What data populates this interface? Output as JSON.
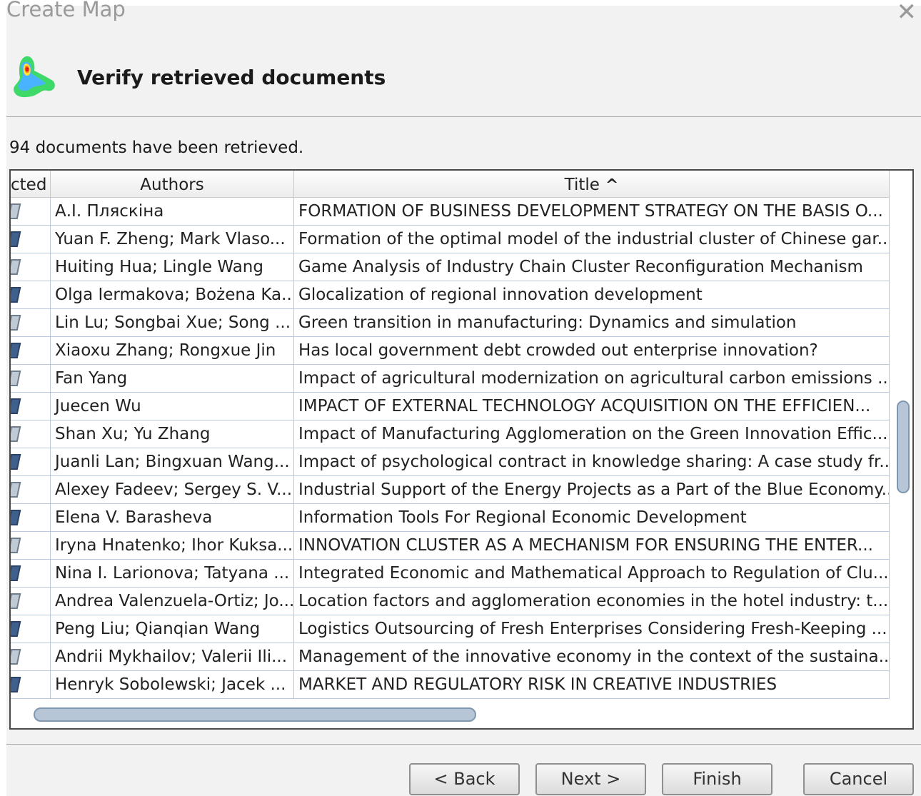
{
  "window": {
    "title": "Create Map",
    "close_glyph": "✕"
  },
  "header": {
    "heading": "Verify retrieved documents",
    "logo_icon": "vosviewer-heatmap-logo"
  },
  "status_text": "94 documents have been retrieved.",
  "table": {
    "columns": {
      "selected": "cted",
      "authors": "Authors",
      "title": "Title"
    },
    "sort_indicator": "^",
    "rows": [
      {
        "authors": "А.І. Пляскіна",
        "title": "FORMATION OF BUSINESS DEVELOPMENT STRATEGY ON THE BASIS O..."
      },
      {
        "authors": "Yuan F. Zheng; Mark Vlaso...",
        "title": "Formation of the optimal model of the industrial cluster of Chinese gar..."
      },
      {
        "authors": "Huiting Hua; Lingle Wang",
        "title": "Game Analysis of Industry Chain Cluster Reconfiguration Mechanism"
      },
      {
        "authors": "Olga Iermakova; Bożena Ka...",
        "title": "Glocalization of regional innovation development"
      },
      {
        "authors": "Lin Lu; Songbai Xue; Song ...",
        "title": "Green transition in manufacturing: Dynamics and simulation"
      },
      {
        "authors": "Xiaoxu Zhang; Rongxue Jin",
        "title": "Has local government debt crowded out enterprise innovation?"
      },
      {
        "authors": "Fan Yang",
        "title": "Impact of agricultural modernization on agricultural carbon emissions ..."
      },
      {
        "authors": "Juecen Wu",
        "title": "IMPACT OF EXTERNAL TECHNOLOGY ACQUISITION ON THE EFFICIEN..."
      },
      {
        "authors": "Shan Xu; Yu Zhang",
        "title": "Impact of Manufacturing Agglomeration on the Green Innovation Effic..."
      },
      {
        "authors": "Juanli Lan; Bingxuan Wang...",
        "title": "Impact of psychological contract in knowledge sharing: A case study fr..."
      },
      {
        "authors": "Alexey Fadeev; Sergey S. V...",
        "title": "Industrial Support of the Energy Projects as a Part of the Blue Economy..."
      },
      {
        "authors": "Elena V. Barasheva",
        "title": "Information Tools For Regional Economic Development"
      },
      {
        "authors": "Iryna Hnatenko; Ihor Kuksa...",
        "title": "INNOVATION CLUSTER AS A MECHANISM FOR ENSURING THE ENTER..."
      },
      {
        "authors": "Nina I. Larionova; Tatyana ...",
        "title": "Integrated Economic and Mathematical Approach to Regulation of Clu..."
      },
      {
        "authors": "Andrea Valenzuela-Ortiz; Jo...",
        "title": "Location factors and agglomeration economies in the hotel industry: t..."
      },
      {
        "authors": "Peng Liu; Qianqian Wang",
        "title": "Logistics Outsourcing of Fresh Enterprises Considering Fresh-Keeping ..."
      },
      {
        "authors": "Andrii Mykhailov; Valerii Ili...",
        "title": "Management of the innovative economy in the context of the sustaina..."
      },
      {
        "authors": "Henryk Sobolewski; Jacek ...",
        "title": "MARKET AND REGULATORY RISK IN CREATIVE INDUSTRIES"
      }
    ]
  },
  "buttons": {
    "back": "< Back",
    "next": "Next >",
    "finish": "Finish",
    "cancel": "Cancel"
  }
}
